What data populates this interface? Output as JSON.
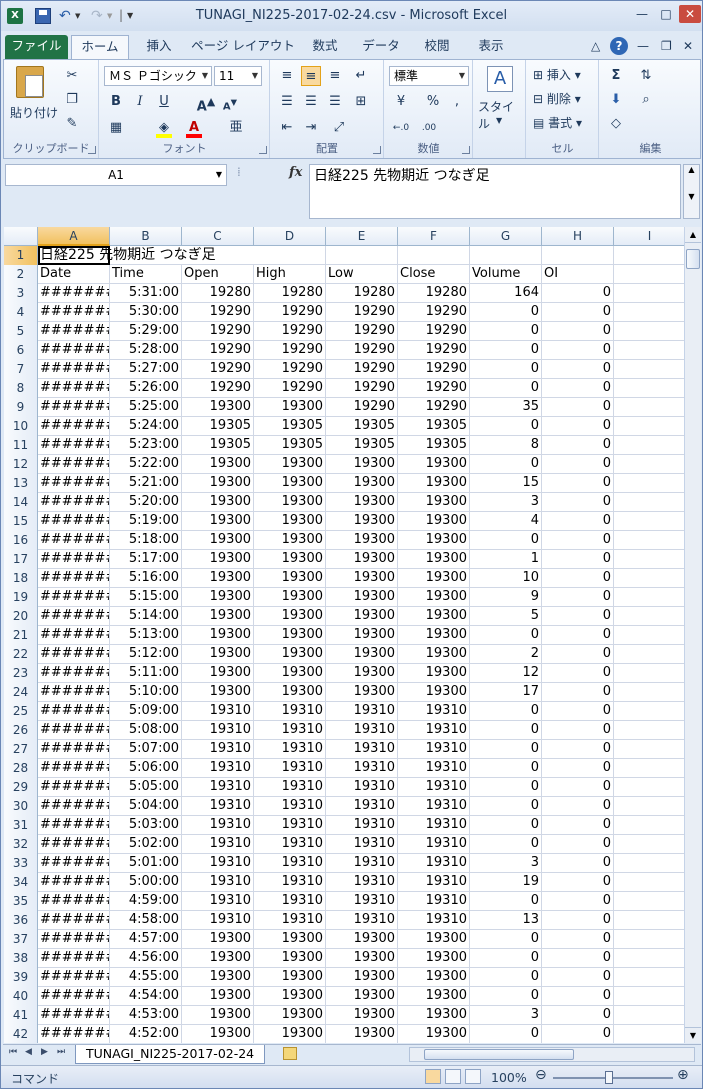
{
  "app": {
    "window_title": "TUNAGI_NI225-2017-02-24.csv - Microsoft Excel",
    "tabs": [
      "ファイル",
      "ホーム",
      "挿入",
      "ページ レイアウト",
      "数式",
      "データ",
      "校閲",
      "表示"
    ]
  },
  "ribbon": {
    "clipboard": {
      "label": "クリップボード",
      "paste": "貼り付け"
    },
    "font": {
      "label": "フォント",
      "name": "ＭＳ Ｐゴシック",
      "size": "11"
    },
    "alignment": {
      "label": "配置"
    },
    "number": {
      "label": "数値",
      "format": "標準",
      "percent": "%",
      "comma": ",",
      "inc_decimal": "←.0",
      "dec_decimal": ".00"
    },
    "style": {
      "label": "スタイル"
    },
    "cells": {
      "label": "セル",
      "insert": "挿入",
      "delete": "削除",
      "format": "書式"
    },
    "editing": {
      "label": "編集"
    }
  },
  "formula_bar": {
    "name_box": "A1",
    "fx": "fx",
    "content": "日経225 先物期近 つなぎ足"
  },
  "grid": {
    "columns": [
      "A",
      "B",
      "C",
      "D",
      "E",
      "F",
      "G",
      "H",
      "I"
    ],
    "title": "日経225 先物期近 つなぎ足",
    "headers": [
      "Date",
      "Time",
      "Open",
      "High",
      "Low",
      "Close",
      "Volume",
      "OI"
    ],
    "rows": [
      [
        "5:31:00",
        "19280",
        "19280",
        "19280",
        "19280",
        "164",
        "0"
      ],
      [
        "5:30:00",
        "19290",
        "19290",
        "19290",
        "19290",
        "0",
        "0"
      ],
      [
        "5:29:00",
        "19290",
        "19290",
        "19290",
        "19290",
        "0",
        "0"
      ],
      [
        "5:28:00",
        "19290",
        "19290",
        "19290",
        "19290",
        "0",
        "0"
      ],
      [
        "5:27:00",
        "19290",
        "19290",
        "19290",
        "19290",
        "0",
        "0"
      ],
      [
        "5:26:00",
        "19290",
        "19290",
        "19290",
        "19290",
        "0",
        "0"
      ],
      [
        "5:25:00",
        "19300",
        "19300",
        "19290",
        "19290",
        "35",
        "0"
      ],
      [
        "5:24:00",
        "19305",
        "19305",
        "19305",
        "19305",
        "0",
        "0"
      ],
      [
        "5:23:00",
        "19305",
        "19305",
        "19305",
        "19305",
        "8",
        "0"
      ],
      [
        "5:22:00",
        "19300",
        "19300",
        "19300",
        "19300",
        "0",
        "0"
      ],
      [
        "5:21:00",
        "19300",
        "19300",
        "19300",
        "19300",
        "15",
        "0"
      ],
      [
        "5:20:00",
        "19300",
        "19300",
        "19300",
        "19300",
        "3",
        "0"
      ],
      [
        "5:19:00",
        "19300",
        "19300",
        "19300",
        "19300",
        "4",
        "0"
      ],
      [
        "5:18:00",
        "19300",
        "19300",
        "19300",
        "19300",
        "0",
        "0"
      ],
      [
        "5:17:00",
        "19300",
        "19300",
        "19300",
        "19300",
        "1",
        "0"
      ],
      [
        "5:16:00",
        "19300",
        "19300",
        "19300",
        "19300",
        "10",
        "0"
      ],
      [
        "5:15:00",
        "19300",
        "19300",
        "19300",
        "19300",
        "9",
        "0"
      ],
      [
        "5:14:00",
        "19300",
        "19300",
        "19300",
        "19300",
        "5",
        "0"
      ],
      [
        "5:13:00",
        "19300",
        "19300",
        "19300",
        "19300",
        "0",
        "0"
      ],
      [
        "5:12:00",
        "19300",
        "19300",
        "19300",
        "19300",
        "2",
        "0"
      ],
      [
        "5:11:00",
        "19300",
        "19300",
        "19300",
        "19300",
        "12",
        "0"
      ],
      [
        "5:10:00",
        "19300",
        "19300",
        "19300",
        "19300",
        "17",
        "0"
      ],
      [
        "5:09:00",
        "19310",
        "19310",
        "19310",
        "19310",
        "0",
        "0"
      ],
      [
        "5:08:00",
        "19310",
        "19310",
        "19310",
        "19310",
        "0",
        "0"
      ],
      [
        "5:07:00",
        "19310",
        "19310",
        "19310",
        "19310",
        "0",
        "0"
      ],
      [
        "5:06:00",
        "19310",
        "19310",
        "19310",
        "19310",
        "0",
        "0"
      ],
      [
        "5:05:00",
        "19310",
        "19310",
        "19310",
        "19310",
        "0",
        "0"
      ],
      [
        "5:04:00",
        "19310",
        "19310",
        "19310",
        "19310",
        "0",
        "0"
      ],
      [
        "5:03:00",
        "19310",
        "19310",
        "19310",
        "19310",
        "0",
        "0"
      ],
      [
        "5:02:00",
        "19310",
        "19310",
        "19310",
        "19310",
        "0",
        "0"
      ],
      [
        "5:01:00",
        "19310",
        "19310",
        "19310",
        "19310",
        "3",
        "0"
      ],
      [
        "5:00:00",
        "19310",
        "19310",
        "19310",
        "19310",
        "19",
        "0"
      ],
      [
        "4:59:00",
        "19310",
        "19310",
        "19310",
        "19310",
        "0",
        "0"
      ],
      [
        "4:58:00",
        "19310",
        "19310",
        "19310",
        "19310",
        "13",
        "0"
      ],
      [
        "4:57:00",
        "19300",
        "19300",
        "19300",
        "19300",
        "0",
        "0"
      ],
      [
        "4:56:00",
        "19300",
        "19300",
        "19300",
        "19300",
        "0",
        "0"
      ],
      [
        "4:55:00",
        "19300",
        "19300",
        "19300",
        "19300",
        "0",
        "0"
      ],
      [
        "4:54:00",
        "19300",
        "19300",
        "19300",
        "19300",
        "0",
        "0"
      ],
      [
        "4:53:00",
        "19300",
        "19300",
        "19300",
        "19300",
        "3",
        "0"
      ],
      [
        "4:52:00",
        "19300",
        "19300",
        "19300",
        "19300",
        "0",
        "0"
      ]
    ],
    "date_placeholder": "########"
  },
  "sheet": {
    "tab_name": "TUNAGI_NI225-2017-02-24"
  },
  "status": {
    "mode": "コマンド",
    "zoom": "100%"
  },
  "icons": [
    "excel-logo-icon",
    "save-icon",
    "undo-icon",
    "redo-icon",
    "help-icon",
    "paste-icon",
    "cut-icon",
    "copy-icon",
    "format-painter-icon",
    "fill-color-icon",
    "font-color-icon",
    "style-icon",
    "sum-icon",
    "sort-icon",
    "find-icon",
    "clear-icon",
    "new-sheet-icon"
  ]
}
